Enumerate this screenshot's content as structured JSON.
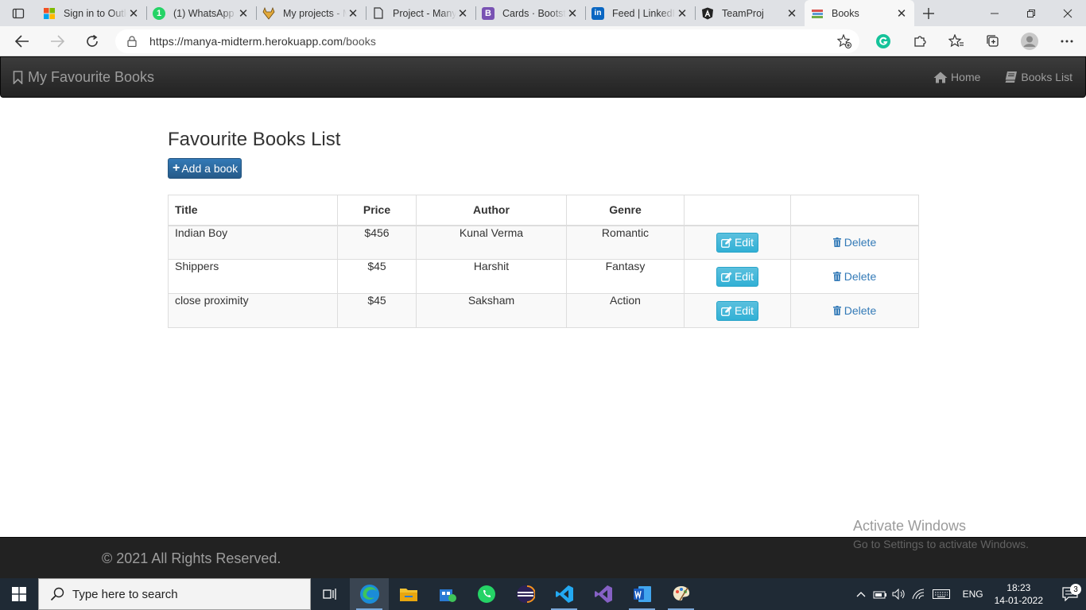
{
  "browser": {
    "tabs": [
      {
        "title": "Sign in to Outlook",
        "favicon": "microsoft-icon",
        "active": false
      },
      {
        "title": "(1) WhatsApp",
        "favicon": "whatsapp-icon",
        "active": false
      },
      {
        "title": "My projects - Mavenlink",
        "favicon": "gitlab-icon",
        "active": false
      },
      {
        "title": "Project - Manya",
        "favicon": "document-icon",
        "active": false
      },
      {
        "title": "Cards · Bootstrap",
        "favicon": "bootstrap-icon",
        "active": false
      },
      {
        "title": "Feed | LinkedIn",
        "favicon": "linkedin-icon",
        "active": false
      },
      {
        "title": "TeamProj",
        "favicon": "angular-icon",
        "active": false
      },
      {
        "title": "Books",
        "favicon": "books-icon",
        "active": true
      }
    ],
    "url_host": "https://manya-midterm.herokuapp.com",
    "url_path": "/books"
  },
  "navbar": {
    "brand": "My Favourite Books",
    "links": [
      {
        "label": "Home",
        "icon": "home-icon"
      },
      {
        "label": "Books List",
        "icon": "book-icon"
      }
    ]
  },
  "main": {
    "title": "Favourite Books List",
    "add_button": "Add a book",
    "table": {
      "headers": [
        "Title",
        "Price",
        "Author",
        "Genre",
        "",
        ""
      ],
      "rows": [
        {
          "title": "Indian Boy",
          "price": "$456",
          "author": "Kunal Verma",
          "genre": "Romantic",
          "edit": "Edit",
          "delete": "Delete"
        },
        {
          "title": "Shippers",
          "price": "$45",
          "author": "Harshit",
          "genre": "Fantasy",
          "edit": "Edit",
          "delete": "Delete"
        },
        {
          "title": "close proximity",
          "price": "$45",
          "author": "Saksham",
          "genre": "Action",
          "edit": "Edit",
          "delete": "Delete"
        }
      ]
    }
  },
  "footer": {
    "copyright": "© 2021 All Rights Reserved."
  },
  "watermark": {
    "line1": "Activate Windows",
    "line2": "Go to Settings to activate Windows."
  },
  "taskbar": {
    "search_placeholder": "Type here to search",
    "language": "ENG",
    "time": "18:23",
    "date": "14-01-2022",
    "notification_count": "3"
  },
  "colors": {
    "primary_button": "#337ab7",
    "info_button": "#5bc0de",
    "navbar_bg": "#222222",
    "link": "#337ab7"
  }
}
